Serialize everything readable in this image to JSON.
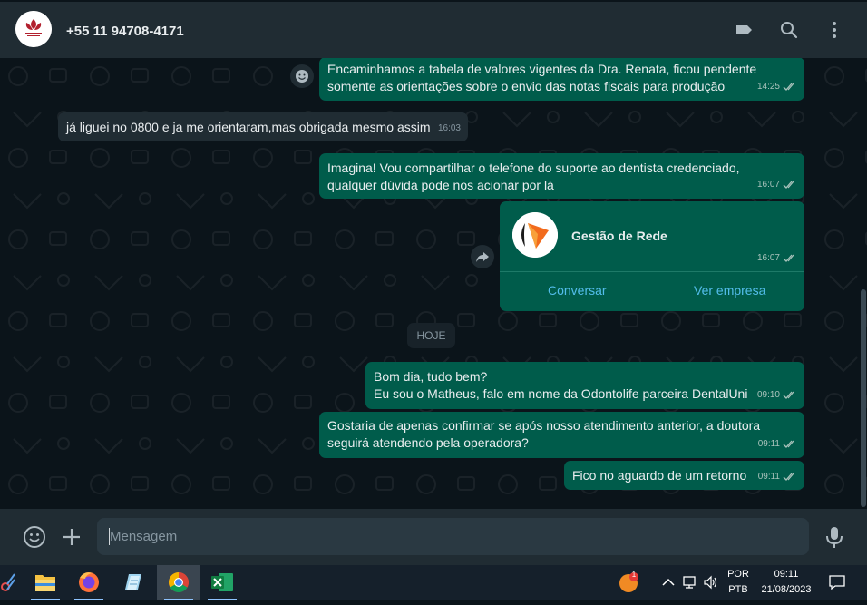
{
  "header": {
    "contact_name": "+55 11 94708-4171",
    "icons": [
      "label-icon",
      "search-icon",
      "menu-icon"
    ]
  },
  "messages": [
    {
      "direction": "out",
      "text": "Encaminhamos a tabela de valores vigentes da Dra. Renata, ficou pendente\nsomente as orientações sobre o envio das notas fiscais para produção",
      "time": "14:25"
    },
    {
      "direction": "in",
      "text": "já liguei no 0800 e ja me orientaram,mas obrigada mesmo assim",
      "time": "16:03"
    },
    {
      "direction": "out",
      "text": "Imagina! Vou compartilhar o telefone do suporte ao dentista credenciado,\nqualquer dúvida pode nos acionar por lá",
      "time": "16:07"
    },
    {
      "direction": "out",
      "text": "Bom dia, tudo bem?\nEu sou o Matheus, falo em nome da Odontolife parceira DentalUni",
      "time": "09:10"
    },
    {
      "direction": "out",
      "text": "Gostaria de apenas confirmar se após nosso atendimento anterior, a doutora\nseguirá atendendo pela operadora?",
      "time": "09:11"
    },
    {
      "direction": "out",
      "text": "Fico no aguardo de um retorno",
      "time": "09:11"
    }
  ],
  "contact_card": {
    "name": "Gestão de Rede",
    "time": "16:07",
    "action_chat": "Conversar",
    "action_business": "Ver empresa"
  },
  "day_separator": "HOJE",
  "composer": {
    "placeholder": "Mensagem"
  },
  "taskbar": {
    "apps": [
      "snipping-tool",
      "file-explorer",
      "firefox",
      "notepad",
      "chrome",
      "excel"
    ],
    "language_top": "POR",
    "language_bottom": "PTB",
    "time": "09:11",
    "date": "21/08/2023",
    "notification_count": "1"
  },
  "colors": {
    "outgoing_bubble": "#005c4b",
    "incoming_bubble": "#202c33",
    "panel": "#202c33",
    "background": "#0b141a",
    "link": "#53bdeb"
  }
}
